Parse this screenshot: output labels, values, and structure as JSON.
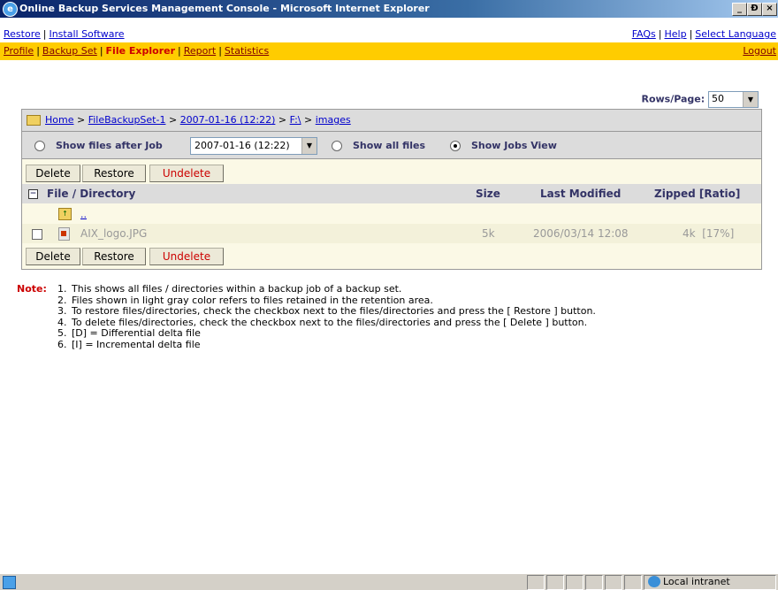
{
  "window": {
    "title": "Online Backup Services Management Console - Microsoft Internet Explorer",
    "controls": [
      "_",
      "Ɖ",
      "×"
    ]
  },
  "top_nav": {
    "left": [
      "Restore",
      "Install Software"
    ],
    "right": [
      "FAQs",
      "Help",
      "Select Language"
    ]
  },
  "main_nav": {
    "items": [
      "Profile",
      "Backup Set",
      "File Explorer",
      "Report",
      "Statistics"
    ],
    "active": "File Explorer",
    "logout": "Logout"
  },
  "rows_per_page": {
    "label": "Rows/Page:",
    "value": "50"
  },
  "breadcrumb": {
    "items": [
      "Home",
      "FileBackupSet-1",
      "2007-01-16 (12:22)",
      "F:\\",
      "images"
    ],
    "separator": ">"
  },
  "filters": {
    "show_files_after_job": "Show files after Job",
    "job_value": "2007-01-16 (12:22)",
    "show_all_files": "Show all files",
    "show_jobs_view": "Show Jobs View",
    "selected": "show_jobs_view"
  },
  "buttons": {
    "delete": "Delete",
    "restore": "Restore",
    "undelete": "Undelete"
  },
  "table": {
    "columns": [
      "File / Directory",
      "Size",
      "Last Modified",
      "Zipped [Ratio]"
    ],
    "parent_link": "..",
    "rows": [
      {
        "name": "AIX_logo.JPG",
        "size": "5k",
        "modified": "2006/03/14 12:08",
        "zipped": "4k  [17%]"
      }
    ]
  },
  "notes": {
    "label": "Note:",
    "items": [
      {
        "num": "1.",
        "text": "This shows all files / directories within a backup job of a backup set."
      },
      {
        "num": "2.",
        "text": "Files shown in light gray color refers to files retained in the retention area."
      },
      {
        "num": "3.",
        "text": "To restore files/directories, check the checkbox next to the files/directories and press the [ Restore ] button."
      },
      {
        "num": "4.",
        "text": "To delete files/directories, check the checkbox next to the files/directories and press the [ Delete ] button."
      },
      {
        "num": "5.",
        "text": "[D] = Differential delta file"
      },
      {
        "num": "6.",
        "text": "[I] = Incremental delta file"
      }
    ]
  },
  "status_bar": {
    "zone": "Local intranet"
  },
  "colors": {
    "title_bar": "#0a246a",
    "nav_bar": "#ffcc00",
    "panel_bg": "#fbf9e6",
    "header_bg": "#dcdcdc",
    "note_label": "#cc0000",
    "undelete": "#cc0000",
    "retained_file_text": "#999999"
  },
  "icons": [
    "ie-icon",
    "folder-icon",
    "folder-up-icon",
    "image-file-icon",
    "collapse-icon",
    "globe-icon",
    "page-icon"
  ]
}
